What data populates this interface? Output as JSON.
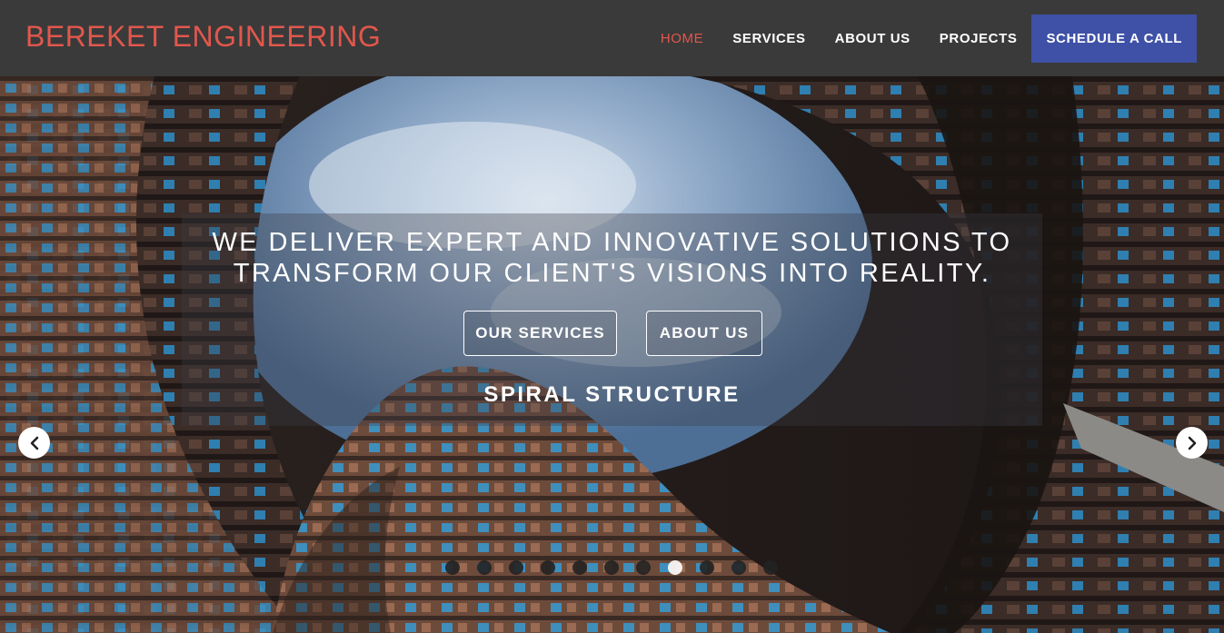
{
  "header": {
    "brand": "BEREKET ENGINEERING",
    "nav": [
      {
        "label": "HOME",
        "active": true
      },
      {
        "label": "SERVICES",
        "active": false
      },
      {
        "label": "ABOUT US",
        "active": false
      },
      {
        "label": "PROJECTS",
        "active": false
      }
    ],
    "cta_label": "SCHEDULE A CALL"
  },
  "hero": {
    "headline_line1": "WE DELIVER EXPERT AND INNOVATIVE SOLUTIONS TO",
    "headline_line2": "TRANSFORM OUR CLIENT'S VISIONS INTO REALITY.",
    "buttons": {
      "services": "OUR SERVICES",
      "about": "ABOUT US"
    },
    "slide_title": "SPIRAL STRUCTURE",
    "prev_icon": "chevron-left-icon",
    "next_icon": "chevron-right-icon",
    "slide_count": 11,
    "active_slide": 8
  },
  "colors": {
    "header_bg": "#3a3a3a",
    "brand": "#e2574c",
    "active_nav": "#e2574c",
    "cta_bg": "#3f51a6"
  }
}
